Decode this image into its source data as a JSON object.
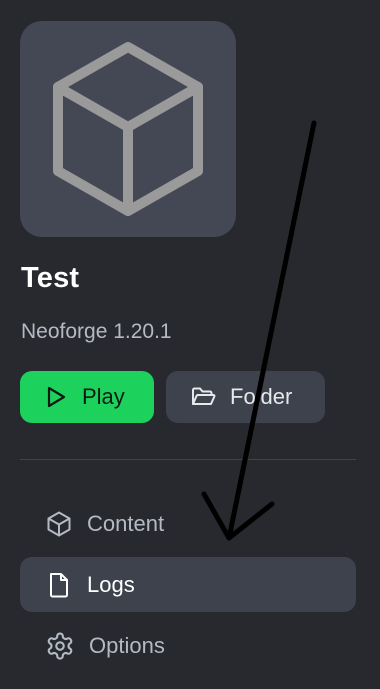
{
  "instance": {
    "title": "Test",
    "version": "Neoforge 1.20.1",
    "icon": "cube-icon"
  },
  "actions": {
    "play_label": "Play",
    "play_icon": "play-icon",
    "folder_label": "Folder",
    "folder_icon": "folder-open-icon"
  },
  "nav": {
    "items": [
      {
        "label": "Content",
        "icon": "box-icon",
        "active": false
      },
      {
        "label": "Logs",
        "icon": "file-icon",
        "active": true
      },
      {
        "label": "Options",
        "icon": "gear-icon",
        "active": false
      }
    ]
  },
  "colors": {
    "background": "#27292f",
    "card": "#434854",
    "accent_green": "#1dd15d",
    "button_dark": "#3e424d",
    "muted_text": "#b4bac4",
    "annotation": "#000000"
  },
  "annotation": {
    "type": "hand-drawn arrow",
    "points_to": "Logs"
  }
}
